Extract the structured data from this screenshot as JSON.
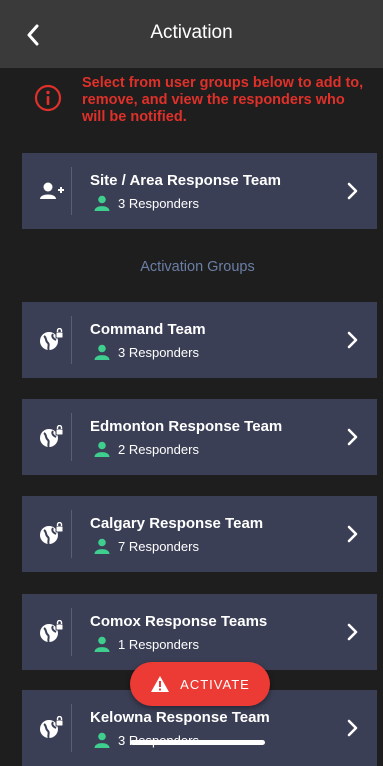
{
  "header": {
    "title": "Activation"
  },
  "info": {
    "message": "Select from user groups below to add to, remove, and view the responders who will be notified."
  },
  "site_team": {
    "name": "Site / Area Response Team",
    "responders": "3 Responders"
  },
  "section_label": "Activation Groups",
  "groups": [
    {
      "name": "Command Team",
      "responders": "3 Responders"
    },
    {
      "name": "Edmonton Response Team",
      "responders": "2 Responders"
    },
    {
      "name": "Calgary Response Team",
      "responders": "7 Responders"
    },
    {
      "name": "Comox Response Teams",
      "responders": "1 Responders"
    },
    {
      "name": "Kelowna Response Team",
      "responders": "3 Responders"
    }
  ],
  "activate_label": "ACTIVATE",
  "colors": {
    "accent_red": "#ec3b35",
    "card_bg": "#3b3f55",
    "responder_green": "#3ecf8e",
    "section_label": "#6b7ea6"
  },
  "icons": {
    "back": "chevron-left-icon",
    "info": "info-circle-icon",
    "site_team": "add-user-icon",
    "group": "globe-lock-icon",
    "responder": "person-icon",
    "row_action": "chevron-right-icon",
    "activate": "warning-triangle-icon"
  }
}
